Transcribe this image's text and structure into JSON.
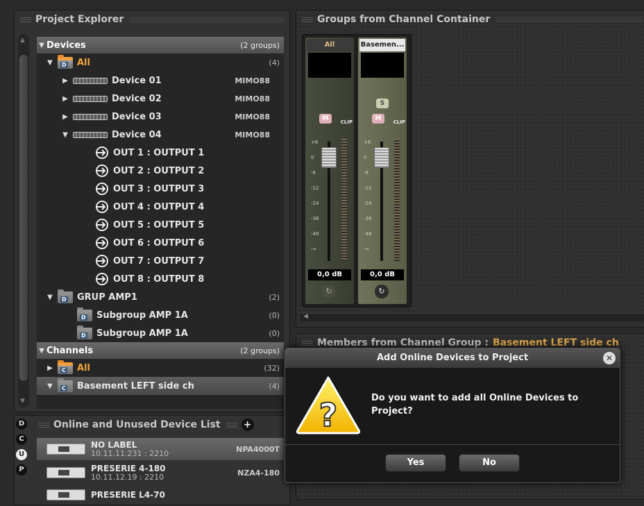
{
  "explorer": {
    "title": "Project Explorer",
    "devices_section": {
      "label": "Devices",
      "count": "(2 groups)"
    },
    "all_group": {
      "label": "All",
      "count": "(4)"
    },
    "devices": [
      {
        "name": "Device 01",
        "model": "MIMO88"
      },
      {
        "name": "Device 02",
        "model": "MIMO88"
      },
      {
        "name": "Device 03",
        "model": "MIMO88"
      },
      {
        "name": "Device 04",
        "model": "MIMO88"
      }
    ],
    "outputs": [
      "OUT 1 : OUTPUT 1",
      "OUT 2 : OUTPUT 2",
      "OUT 3 : OUTPUT 3",
      "OUT 4 : OUTPUT 4",
      "OUT 5 : OUTPUT 5",
      "OUT 6 : OUTPUT 6",
      "OUT 7 : OUTPUT 7",
      "OUT 8 : OUTPUT 8"
    ],
    "grup_amp": {
      "label": "GRUP AMP1",
      "count": "(2)"
    },
    "subgroups": [
      {
        "label": "Subgroup AMP 1A",
        "count": "(0)"
      },
      {
        "label": "Subgroup AMP 1A",
        "count": "(0)"
      }
    ],
    "channels_section": {
      "label": "Channels",
      "count": "(2 groups)"
    },
    "channel_groups": [
      {
        "label": "All",
        "count": "(32)"
      },
      {
        "label": "Basement LEFT side ch",
        "count": "(4)"
      }
    ]
  },
  "groups": {
    "title": "Groups from Channel Container",
    "strips": [
      {
        "name": "All",
        "mute": "M",
        "clip": "CLIP",
        "db": "0,0 dB",
        "scale": [
          "+6",
          "0",
          "-6",
          "-12",
          "-24",
          "-36",
          "-48",
          "-∞"
        ]
      },
      {
        "name": "Basemen...",
        "solo": "S",
        "mute": "M",
        "clip": "CLIP",
        "db": "0,0 dB",
        "scale": [
          "+6",
          "0",
          "-6",
          "-12",
          "-24",
          "-36",
          "-48",
          "-∞"
        ]
      }
    ]
  },
  "members": {
    "title_prefix": "Members from Channel Group :",
    "group_name": "Basement LEFT side ch"
  },
  "online": {
    "title": "Online and Unused Device List",
    "side_buttons": [
      "D",
      "C",
      "U",
      "P"
    ],
    "devices": [
      {
        "name": "NO LABEL",
        "ip": "10.11.11.231 : 2210",
        "model": "NPA4000T"
      },
      {
        "name": "PRESERIE 4-180",
        "ip": "10.11.12.19 : 2210",
        "model": "NZA4-180"
      },
      {
        "name": "PRESERIE L4-70",
        "ip": "",
        "model": ""
      }
    ]
  },
  "dialog": {
    "title": "Add Online Devices to Project",
    "message": "Do you want to add all Online Devices to Project?",
    "yes_label": "Yes",
    "no_label": "No"
  },
  "colors": {
    "accent_orange": "#f0a53a",
    "dialog_bg": "#191919",
    "panel_bg": "#323232"
  }
}
